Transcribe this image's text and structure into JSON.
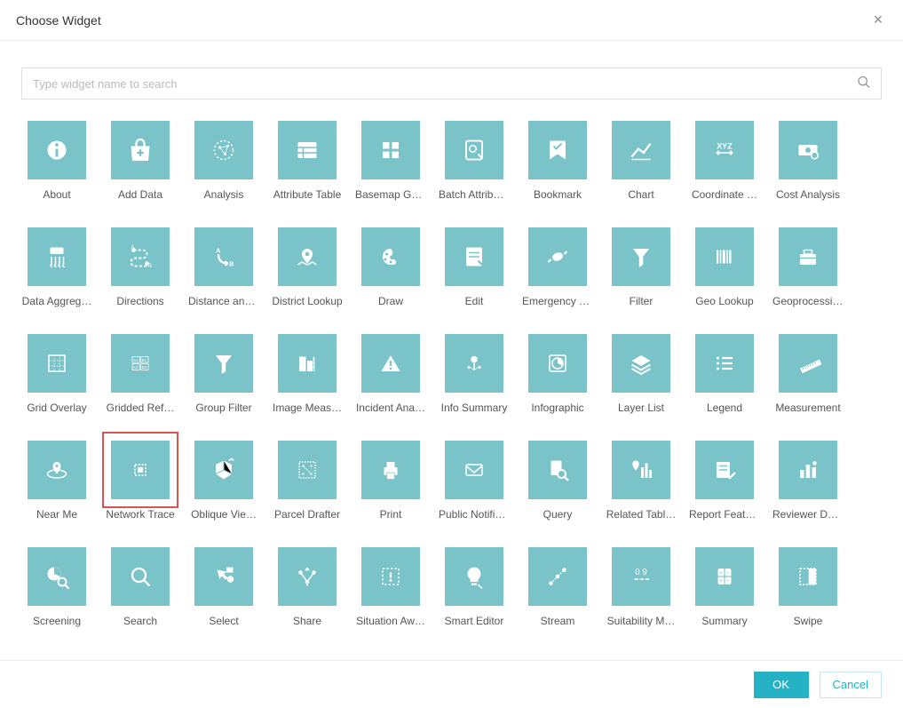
{
  "dialog": {
    "title": "Choose Widget",
    "close": "×"
  },
  "search": {
    "placeholder": "Type widget name to search"
  },
  "buttons": {
    "ok": "OK",
    "cancel": "Cancel"
  },
  "widgets": [
    {
      "name": "about",
      "label": "About",
      "icon": "info"
    },
    {
      "name": "add-data",
      "label": "Add Data",
      "icon": "bag-plus"
    },
    {
      "name": "analysis",
      "label": "Analysis",
      "icon": "circle-net"
    },
    {
      "name": "attribute-table",
      "label": "Attribute Table",
      "icon": "table"
    },
    {
      "name": "basemap-gallery",
      "label": "Basemap Ga…",
      "icon": "grid4"
    },
    {
      "name": "batch-attribute",
      "label": "Batch Attribu…",
      "icon": "gear-edit"
    },
    {
      "name": "bookmark",
      "label": "Bookmark",
      "icon": "bookmark"
    },
    {
      "name": "chart",
      "label": "Chart",
      "icon": "chart"
    },
    {
      "name": "coordinate-conv",
      "label": "Coordinate …",
      "icon": "xyz"
    },
    {
      "name": "cost-analysis",
      "label": "Cost Analysis",
      "icon": "money"
    },
    {
      "name": "data-aggregation",
      "label": "Data Aggreg…",
      "icon": "rain"
    },
    {
      "name": "directions",
      "label": "Directions",
      "icon": "route"
    },
    {
      "name": "distance-direction",
      "label": "Distance and…",
      "icon": "ab-arrow"
    },
    {
      "name": "district-lookup",
      "label": "District Lookup",
      "icon": "pin-area"
    },
    {
      "name": "draw",
      "label": "Draw",
      "icon": "palette"
    },
    {
      "name": "edit",
      "label": "Edit",
      "icon": "note-edit"
    },
    {
      "name": "emergency-response",
      "label": "Emergency R…",
      "icon": "candy"
    },
    {
      "name": "filter",
      "label": "Filter",
      "icon": "funnel"
    },
    {
      "name": "geo-lookup",
      "label": "Geo Lookup",
      "icon": "barcode"
    },
    {
      "name": "geoprocessing",
      "label": "Geoprocessing",
      "icon": "toolbox"
    },
    {
      "name": "grid-overlay",
      "label": "Grid Overlay",
      "icon": "grid-dash"
    },
    {
      "name": "gridded-ref",
      "label": "Gridded Ref…",
      "icon": "ref-grid"
    },
    {
      "name": "group-filter",
      "label": "Group Filter",
      "icon": "funnel-solid"
    },
    {
      "name": "image-meas",
      "label": "Image Meas…",
      "icon": "building-ruler"
    },
    {
      "name": "incident-analysis",
      "label": "Incident Ana…",
      "icon": "warn"
    },
    {
      "name": "info-summary",
      "label": "Info Summary",
      "icon": "pin-dots"
    },
    {
      "name": "infographic",
      "label": "Infographic",
      "icon": "pie-box"
    },
    {
      "name": "layer-list",
      "label": "Layer List",
      "icon": "layers"
    },
    {
      "name": "legend",
      "label": "Legend",
      "icon": "list"
    },
    {
      "name": "measurement",
      "label": "Measurement",
      "icon": "ruler"
    },
    {
      "name": "near-me",
      "label": "Near Me",
      "icon": "pin-radius"
    },
    {
      "name": "network-trace",
      "label": "Network Trace",
      "icon": "dash-grid",
      "selected": true
    },
    {
      "name": "oblique-viewer",
      "label": "Oblique Vie…",
      "icon": "box3d"
    },
    {
      "name": "parcel-drafter",
      "label": "Parcel Drafter",
      "icon": "parcel"
    },
    {
      "name": "print",
      "label": "Print",
      "icon": "printer"
    },
    {
      "name": "public-notif",
      "label": "Public Notific…",
      "icon": "mail"
    },
    {
      "name": "query",
      "label": "Query",
      "icon": "doc-search"
    },
    {
      "name": "related-table",
      "label": "Related Tabl…",
      "icon": "pin-bars"
    },
    {
      "name": "report-feature",
      "label": "Report Feature",
      "icon": "note-check"
    },
    {
      "name": "reviewer-dash",
      "label": "Reviewer Da…",
      "icon": "bars-mark"
    },
    {
      "name": "screening",
      "label": "Screening",
      "icon": "pie-search"
    },
    {
      "name": "search",
      "label": "Search",
      "icon": "search"
    },
    {
      "name": "select",
      "label": "Select",
      "icon": "cursor-shapes"
    },
    {
      "name": "share",
      "label": "Share",
      "icon": "share"
    },
    {
      "name": "situation-aware",
      "label": "Situation Aw…",
      "icon": "dash-bang"
    },
    {
      "name": "smart-editor",
      "label": "Smart Editor",
      "icon": "bulb"
    },
    {
      "name": "stream",
      "label": "Stream",
      "icon": "stream"
    },
    {
      "name": "suitability",
      "label": "Suitability M…",
      "icon": "zero-nine"
    },
    {
      "name": "summary",
      "label": "Summary",
      "icon": "calc"
    },
    {
      "name": "swipe",
      "label": "Swipe",
      "icon": "swipe"
    }
  ]
}
